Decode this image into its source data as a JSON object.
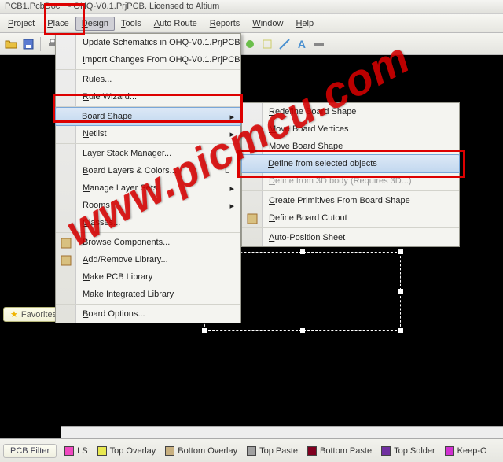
{
  "title": "PCB1.PcbDoc * - OHQ-V0.1.PrjPCB. Licensed to Altium",
  "menubar": [
    "Project",
    "Place",
    "Design",
    "Tools",
    "Auto Route",
    "Reports",
    "Window",
    "Help"
  ],
  "menubar_active_index": 2,
  "viewmode": "Altium Standard 2D",
  "design_menu": [
    {
      "label": "Update Schematics in OHQ-V0.1.PrjPCB"
    },
    {
      "label": "Import Changes From OHQ-V0.1.PrjPCB",
      "sep": true
    },
    {
      "label": "Rules..."
    },
    {
      "label": "Rule Wizard...",
      "sep": true
    },
    {
      "label": "Board Shape",
      "arrow": true,
      "hover": true
    },
    {
      "label": "Netlist",
      "arrow": true,
      "sep": true
    },
    {
      "label": "Layer Stack Manager..."
    },
    {
      "label": "Board Layers & Colors...",
      "shortcut": "L"
    },
    {
      "label": "Manage Layer Sets",
      "arrow": true
    },
    {
      "label": "Rooms",
      "arrow": true
    },
    {
      "label": "Classes...",
      "sep": true
    },
    {
      "label": "Browse Components...",
      "icon": "browse"
    },
    {
      "label": "Add/Remove Library...",
      "icon": "lib"
    },
    {
      "label": "Make PCB Library"
    },
    {
      "label": "Make Integrated Library",
      "sep": true
    },
    {
      "label": "Board Options..."
    }
  ],
  "boardshape_menu": [
    {
      "label": "Redefine Board Shape"
    },
    {
      "label": "Move Board Vertices"
    },
    {
      "label": "Move Board Shape"
    },
    {
      "label": "Define from selected objects",
      "hover": true
    },
    {
      "label": "Define from 3D body (Requires 3D...)",
      "disabled": true,
      "sep": true
    },
    {
      "label": "Create Primitives From Board Shape"
    },
    {
      "label": "Define Board Cutout",
      "icon": "cutout",
      "sep": true
    },
    {
      "label": "Auto-Position Sheet"
    }
  ],
  "favorites": "Favorites",
  "bottom_tab": "PCB Filter",
  "layers": [
    {
      "name": "LS",
      "color": "#f048c0"
    },
    {
      "name": "Top Overlay",
      "color": "#e8e850"
    },
    {
      "name": "Bottom Overlay",
      "color": "#c8b080"
    },
    {
      "name": "Top Paste",
      "color": "#a0a0a0"
    },
    {
      "name": "Bottom Paste",
      "color": "#800020"
    },
    {
      "name": "Top Solder",
      "color": "#7030a0"
    },
    {
      "name": "Keep-O",
      "color": "#d030d0"
    }
  ],
  "watermark": "www.picmcu.com"
}
